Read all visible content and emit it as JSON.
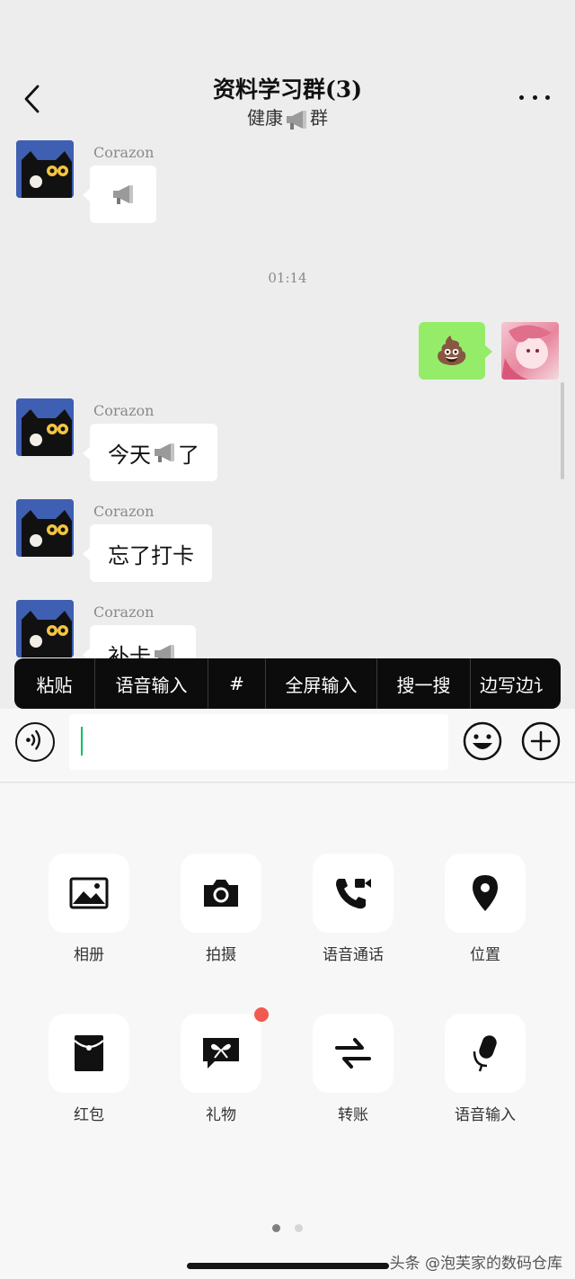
{
  "header": {
    "title": "资料学习群(3)",
    "subtitle_before": "健康",
    "subtitle_after": "群"
  },
  "messages": [
    {
      "sender": "Corazon",
      "text_before": "",
      "text_after": ""
    },
    {
      "time": "01:14"
    },
    {
      "sender": "Corazon",
      "text_before": "今天",
      "text_after": "了"
    },
    {
      "sender": "Corazon",
      "text": "忘了打卡"
    },
    {
      "sender": "Corazon",
      "text_before": "补卡",
      "text_after": ""
    }
  ],
  "my_message": {
    "emoji": "💩"
  },
  "context_menu": [
    "粘贴",
    "语音输入",
    "#",
    "全屏输入",
    "搜一搜",
    "边写边讠"
  ],
  "input": {
    "value": ""
  },
  "panel": {
    "items": [
      {
        "label": "相册",
        "icon": "photo-album-icon"
      },
      {
        "label": "拍摄",
        "icon": "camera-icon"
      },
      {
        "label": "语音通话",
        "icon": "voice-call-icon"
      },
      {
        "label": "位置",
        "icon": "location-icon"
      },
      {
        "label": "红包",
        "icon": "red-packet-icon"
      },
      {
        "label": "礼物",
        "icon": "gift-icon",
        "badge": true
      },
      {
        "label": "转账",
        "icon": "transfer-icon"
      },
      {
        "label": "语音输入",
        "icon": "microphone-icon"
      }
    ],
    "page_count": 2,
    "current_page": 1
  },
  "watermark": "头条 @泡芙家的数码仓库",
  "colors": {
    "accent": "#07c160",
    "my_bubble": "#95ec69",
    "badge": "#f05a4f",
    "menu_bg": "#0c0c0c"
  }
}
